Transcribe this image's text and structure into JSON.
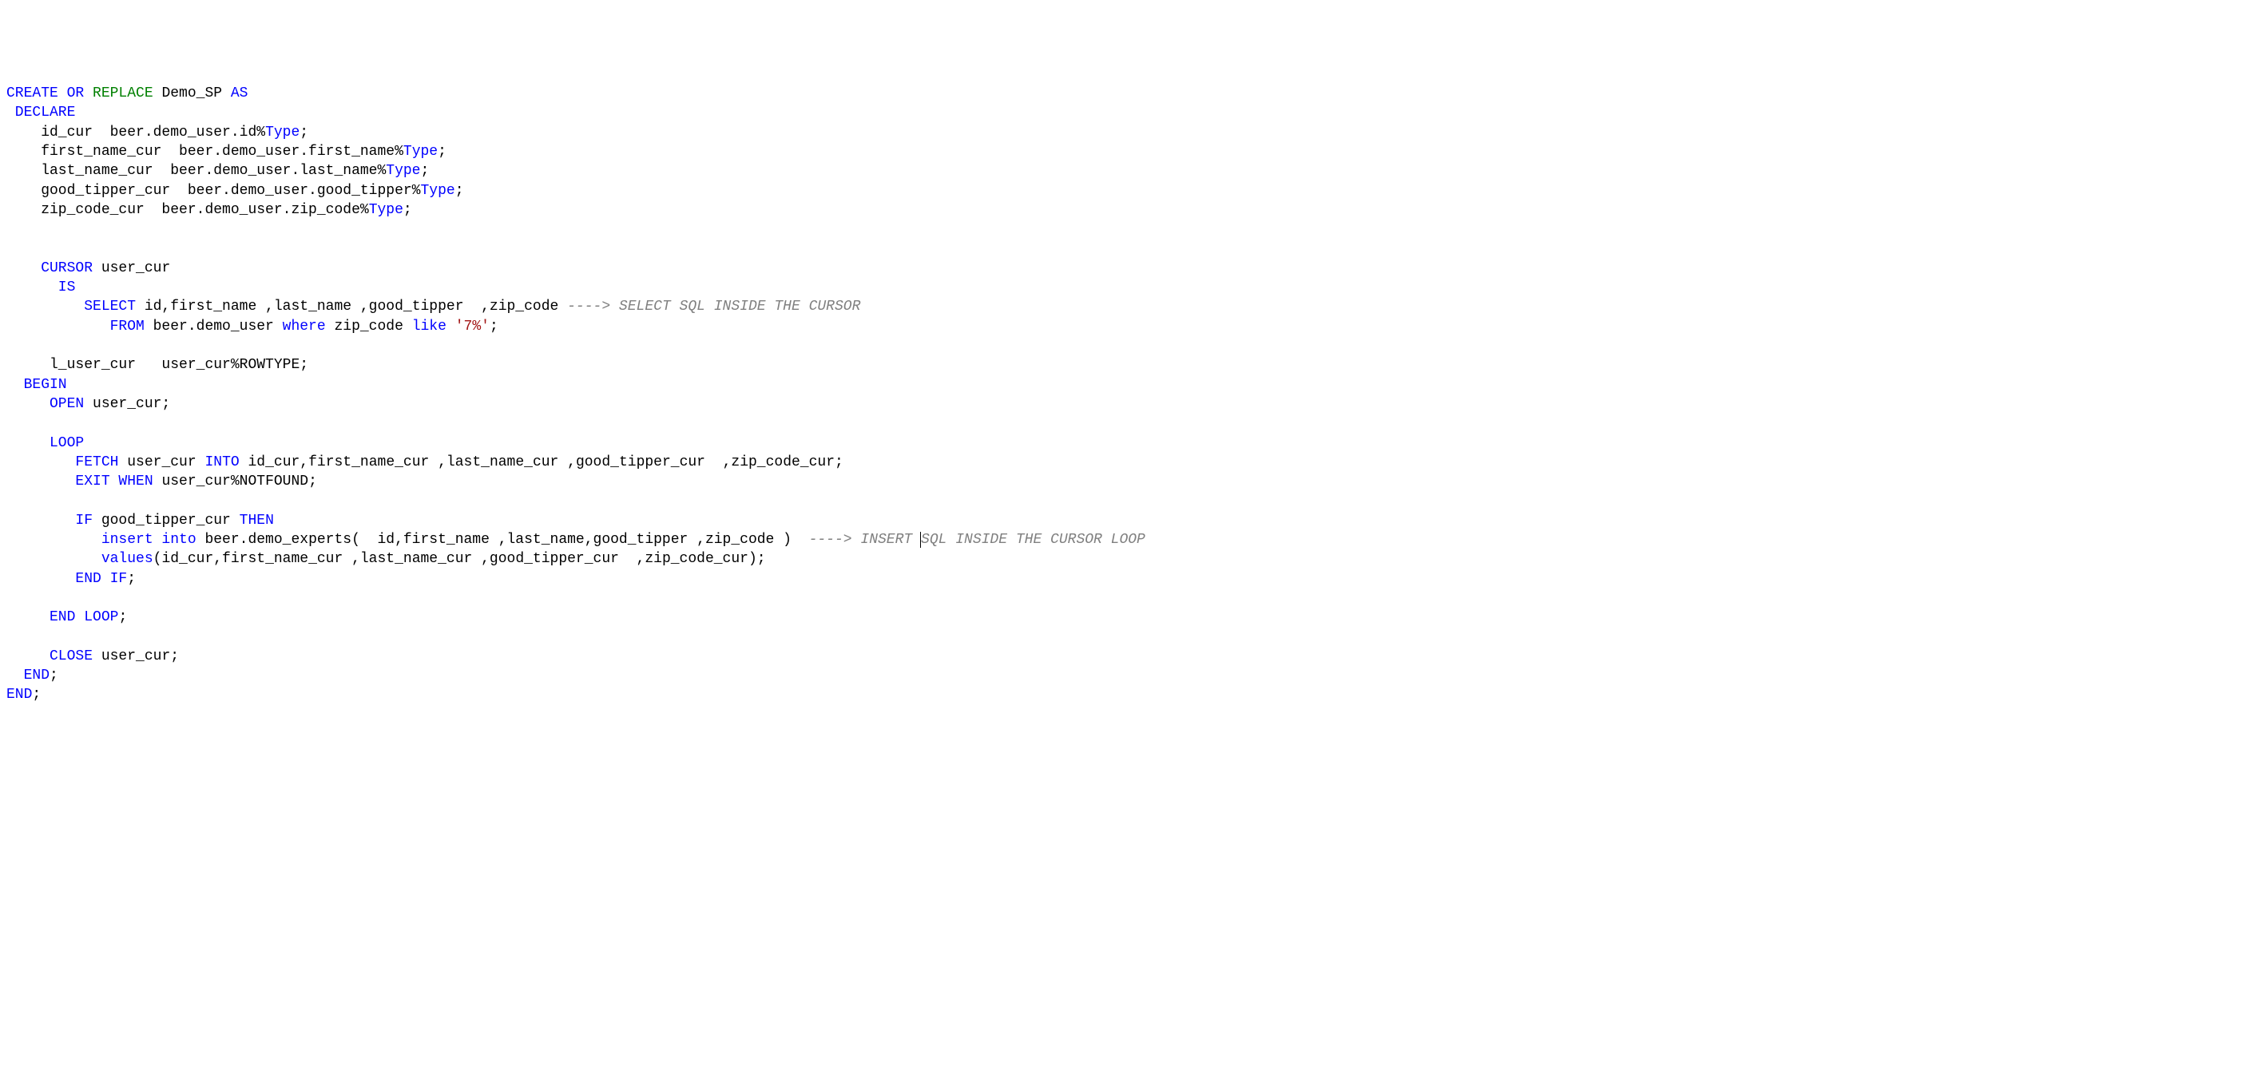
{
  "code": {
    "line1": {
      "t1": "CREATE OR ",
      "t2": "REPLACE",
      "t3": " Demo_SP ",
      "t4": "AS"
    },
    "line2": {
      "t1": " DECLARE"
    },
    "line3": {
      "t1": "    id_cur  beer.demo_user.id%",
      "t2": "Type",
      "t3": ";"
    },
    "line4": {
      "t1": "    first_name_cur  beer.demo_user.first_name%",
      "t2": "Type",
      "t3": ";"
    },
    "line5": {
      "t1": "    last_name_cur  beer.demo_user.last_name%",
      "t2": "Type",
      "t3": ";"
    },
    "line6": {
      "t1": "    good_tipper_cur  beer.demo_user.good_tipper%",
      "t2": "Type",
      "t3": ";"
    },
    "line7": {
      "t1": "    zip_code_cur  beer.demo_user.zip_code%",
      "t2": "Type",
      "t3": ";"
    },
    "line8": "",
    "line9": "",
    "line10": {
      "t1": "    CURSOR",
      "t2": " user_cur"
    },
    "line11": {
      "t1": "      IS"
    },
    "line12": {
      "t1": "         SELECT",
      "t2": " id,first_name ,last_name ,good_tipper  ,zip_code ",
      "t3": "----> SELECT SQL INSIDE THE CURSOR"
    },
    "line13": {
      "t1": "            FROM",
      "t2": " beer.demo_user ",
      "t3": "where",
      "t4": " zip_code ",
      "t5": "like",
      "t6": " ",
      "t7": "'7%'",
      "t8": ";"
    },
    "line14": "",
    "line15": {
      "t1": "     l_user_cur   user_cur%ROWTYPE;"
    },
    "line16": {
      "t1": "  BEGIN"
    },
    "line17": {
      "t1": "     OPEN",
      "t2": " user_cur;"
    },
    "line18": "",
    "line19": {
      "t1": "     LOOP"
    },
    "line20": {
      "t1": "        FETCH",
      "t2": " user_cur ",
      "t3": "INTO",
      "t4": " id_cur,first_name_cur ,last_name_cur ,good_tipper_cur  ,zip_code_cur;"
    },
    "line21": {
      "t1": "        EXIT WHEN",
      "t2": " user_cur%NOTFOUND;"
    },
    "line22": "",
    "line23": {
      "t1": "        IF",
      "t2": " good_tipper_cur ",
      "t3": "THEN"
    },
    "line24": {
      "t1": "           insert into",
      "t2": " beer.demo_experts(  id,first_name ,last_name,good_tipper ,zip_code )  ",
      "t3": "----> INSERT ",
      "t4": "SQL INSIDE THE CURSOR LOOP"
    },
    "line25": {
      "t1": "           values",
      "t2": "(id_cur,first_name_cur ,last_name_cur ,good_tipper_cur  ,zip_code_cur);"
    },
    "line26": {
      "t1": "        END IF",
      "t2": ";"
    },
    "line27": "",
    "line28": {
      "t1": "     END LOOP",
      "t2": ";"
    },
    "line29": "",
    "line30": {
      "t1": "     CLOSE",
      "t2": " user_cur;"
    },
    "line31": {
      "t1": "  END",
      "t2": ";"
    },
    "line32": {
      "t1": "END",
      "t2": ";"
    }
  }
}
